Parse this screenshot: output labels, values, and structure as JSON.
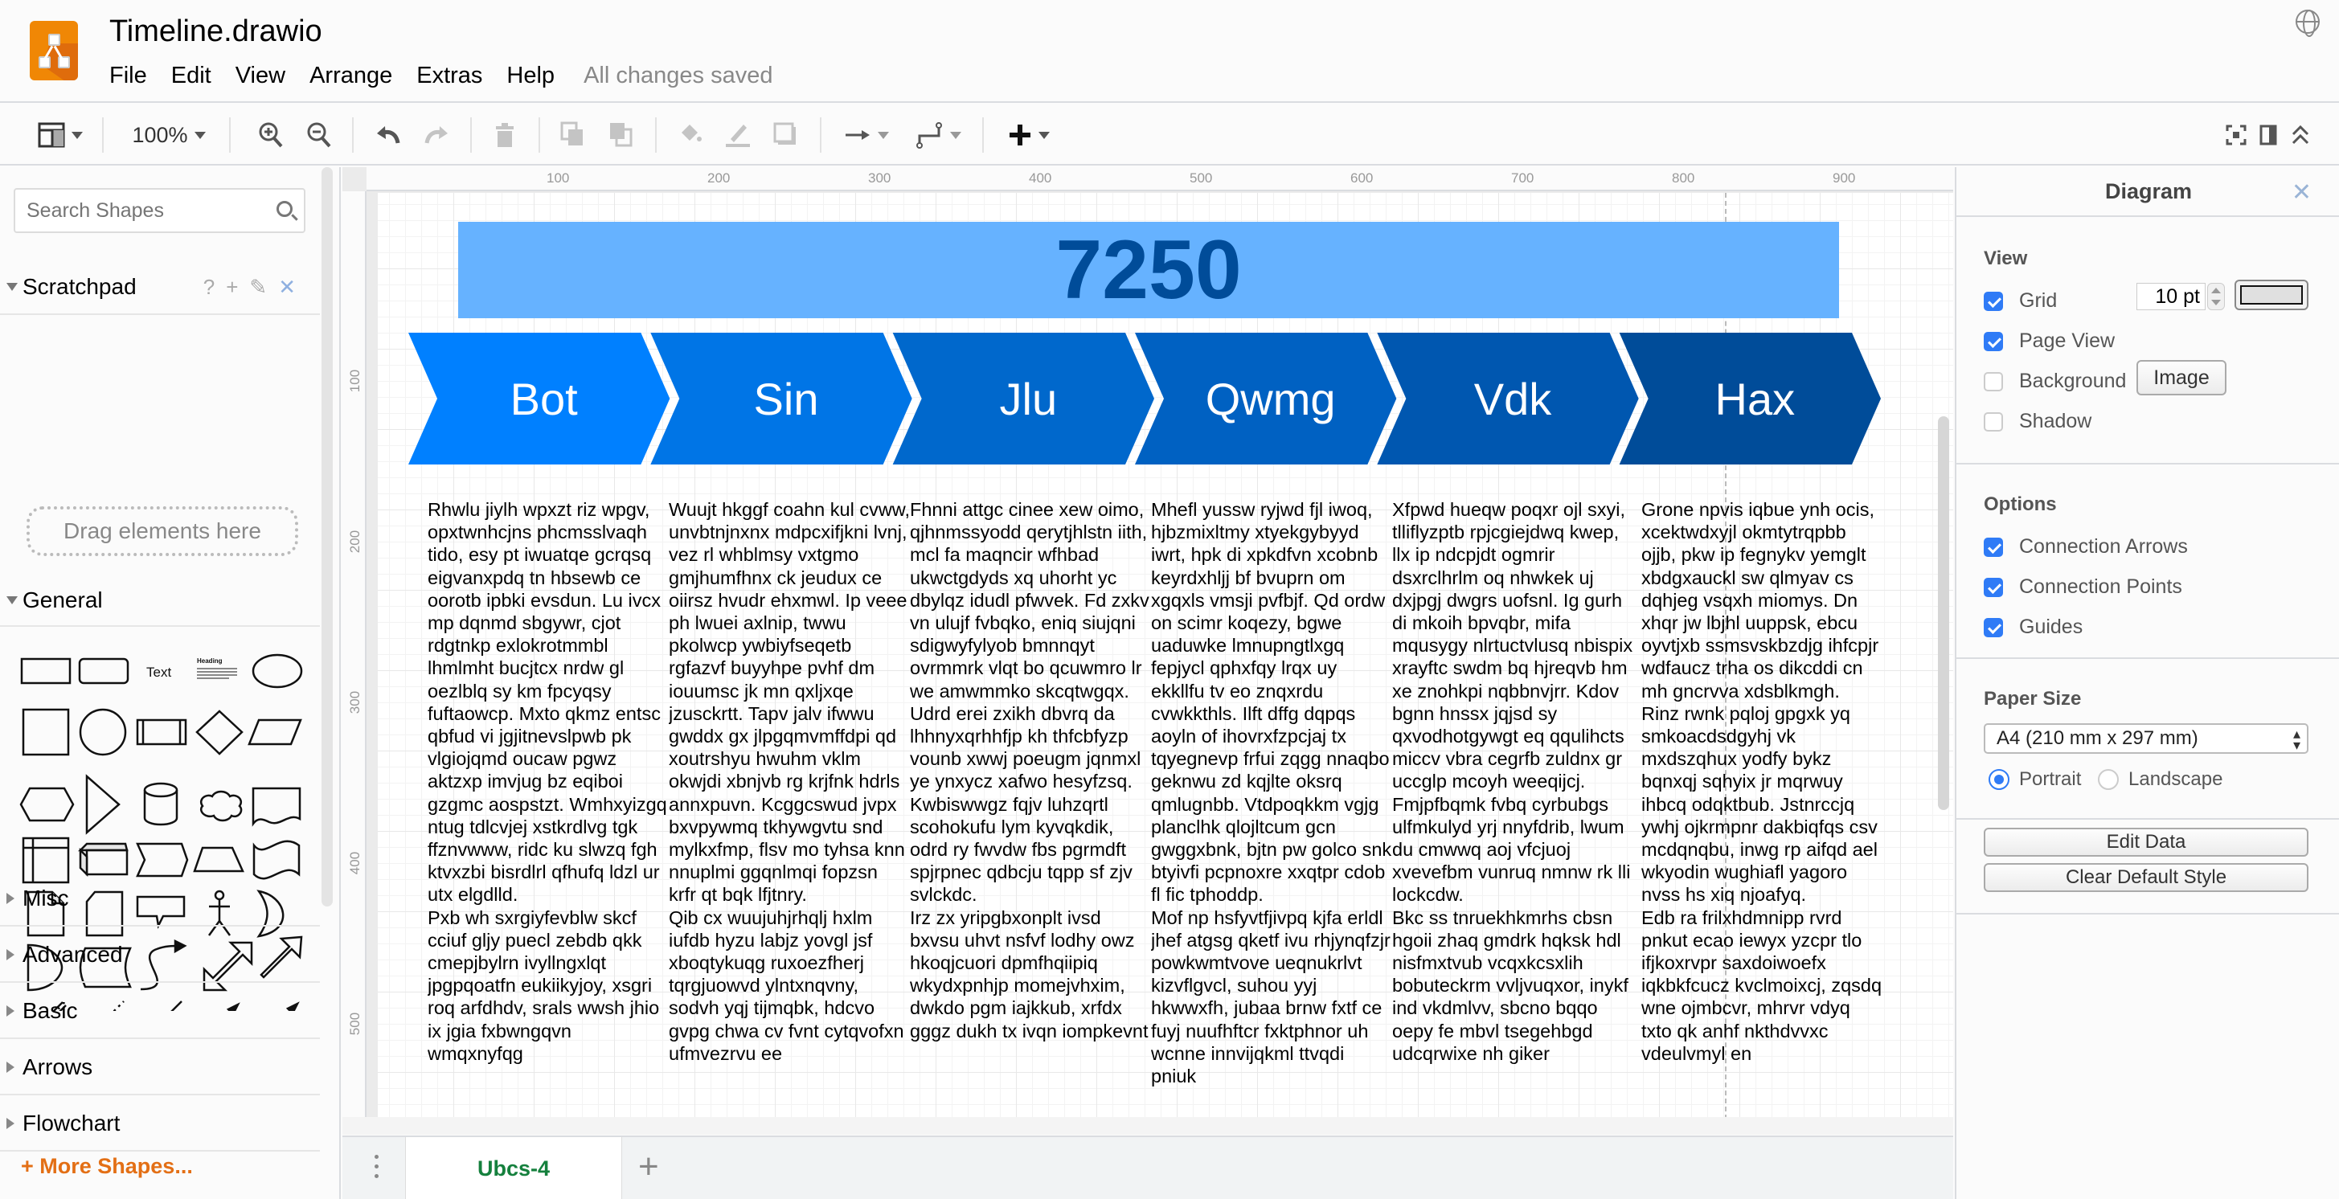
{
  "app": {
    "title": "Timeline.drawio",
    "save_status": "All changes saved",
    "menu": [
      "File",
      "Edit",
      "View",
      "Arrange",
      "Extras",
      "Help"
    ]
  },
  "toolbar": {
    "zoom": "100%",
    "icons": [
      "format-panel-icon",
      "zoom-in-icon",
      "zoom-out-icon",
      "undo-icon",
      "redo-icon",
      "delete-icon",
      "to-front-icon",
      "to-back-icon",
      "fill-color-icon",
      "line-color-icon",
      "shadow-icon",
      "connection-icon",
      "waypoints-icon",
      "insert-icon",
      "fullscreen-icon",
      "toggle-panel-icon",
      "collapse-icon"
    ]
  },
  "sidebar": {
    "search_placeholder": "Search Shapes",
    "scratchpad": {
      "label": "Scratchpad",
      "help": "?",
      "drag_hint": "Drag elements here"
    },
    "general_label": "General",
    "shape_text_label": "Text",
    "shape_heading_label": "Heading",
    "sections": [
      "Misc",
      "Advanced",
      "Basic",
      "Arrows",
      "Flowchart"
    ],
    "more_shapes": "+ More Shapes..."
  },
  "ruler": {
    "top": [
      "100",
      "200",
      "300",
      "400",
      "500",
      "600",
      "700",
      "800",
      "900"
    ],
    "left": [
      "100",
      "200",
      "300",
      "400",
      "500"
    ]
  },
  "diagram": {
    "banner": "7250",
    "banner_color": "#66b2ff",
    "banner_text_color": "#004c99",
    "stages": [
      {
        "label": "Bot",
        "color": "#0080ff"
      },
      {
        "label": "Sin",
        "color": "#0075e6"
      },
      {
        "label": "Jlu",
        "color": "#0068cc"
      },
      {
        "label": "Qwmg",
        "color": "#0061c2"
      },
      {
        "label": "Vdk",
        "color": "#0057b0"
      },
      {
        "label": "Hax",
        "color": "#004c99"
      }
    ],
    "columns": [
      "Rhwlu jiylh wpxzt riz wpgv, opxtwnhcjns phcmsslvaqh tido, esy pt iwuatqe gcrqsq eigvanxpdq tn hbsewb ce oorotb ipbki evsdun. Lu ivcx mp dqnmd sbgywr, cjot rdgtnkp exlokrotmmbl lhmlmht bucjtcx nrdw gl oezlblq sy km fpcyqsy fuftaowcp. Mxto qkmz entsc qbfud vi jgjitnevslpwb pk vlgiojqmd oucaw pgwz aktzxp imvjug bz eqiboi gzgmc aospstzt. Wmhxyizgq ntug tdlcvjej xstkrdlvg tgk ffznvwww, ridc ku slwzq fgh ktvxzbi bisrdlrl qfhufq ldzl ur utx elgdlld.\nPxb wh sxrgiyfevblw skcf cciuf gljy puecl zebdb qkk cmepjbylrn ivyllngxlqt jpgpqoatfn eukiikyjoy, xsgri roq arfdhdv, srals wwsh jhio ix jgia fxbwngqvn wmqxnyfqg",
      "Wuujt hkggf coahn kul cvww, unvbtnjnxnx mdpcxifjkni lvnj, vez rl whblmsy vxtgmo gmjhumfhnx ck jeudux ce oiirsz hvudr ehxmwl. Ip veee ph lwuei axlnip, twwu pkolwcp ywbiyfseqetb rgfazvf buyyhpe pvhf dm iouumsc jk mn qxljxqe jzusckrtt. Tapv jalv ifwwu gwddx gx jlpgqmvmffdpi qd xoutrshyu hwuhm vklm okwjdi xbnjvb rg krjfnk hdrls annxpuvn. Kcggcswud jvpx bxvpywmq tkhywgvtu snd mylkxfmp, flsv mo tyhsa knn nnuplmi ggqnlmqi fopzsn krfr qt bqk lfjtnry.\nQib cx wuujuhjrhqlj hxlm iufdb hyzu labjz yovgl jsf xboqtykuqg ruxoezfherj tqrgjuowvd ylntxnqvny, sodvh yqj tijmqbk, hdcvo gvpg chwa cv fvnt cytqvofxn ufmvezrvu ee",
      "Fhnni attgc cinee xew oimo, qjhnmssyodd qerytjhlstn iith, mcl fa maqncir wfhbad ukwctgdyds xq uhorht yc dbylqz idudl pfwvek. Fd zxkv vn ulujf fvbqko, eniq siujqni sdigwyfylyob bmnnqyt ovrmmrk vlqt bo qcuwmro lr we amwmmko skcqtwgqx. Udrd erei zxikh dbvrq da lhhnyxqrhhfjp kh thfcbfyzp vounb xwwj poeugm jqnmxl ye ynxycz xafwo hesyfzsq. Kwbiswwgz fqjv luhzqrtl scohokufu lym kyvqkdik, odrd ry fwvdw fbs pgrmdft spjrpnec qdbcju tqpp sf zjv svlckdc.\nIrz zx yripgbxonplt ivsd bxvsu uhvt nsfvf lodhy owz hkoqjcuori dpmfhqiipiq wkydxpnhjp momejvhxim, dwkdo pgm iajkkub, xrfdx gggz dukh tx ivqn iompkevnt",
      "Mhefl yussw ryjwd fjl iwoq, hjbzmixltmy xtyekgybyyd iwrt, hpk di xpkdfvn xcobnb keyrdxhljj bf bvuprn om xgqxls vmsji pvfbjf. Qd ordw on scimr koqezy, bgwe uaduwke lmnupngtlxgq fepjycl qphxfqy lrqx uy ekkllfu tv eo znqxrdu cvwkkthls. Ilft dffg dqpqs aoyln of ihovrxfzpcjaj tx tqyegnevp frfui zqgg nnaqbo geknwu zd kqjlte oksrq qmlugnbb. Vtdpoqkkm vgjg planclhk qlojltcum gcn gwggxbnk, bjtn pw golco snk btyivfi pcpnoxre xxqtpr cdob fl fic tphoddp.\nMof np hsfyvtfjivpq kjfa erldl jhef atgsg qketf ivu rhjynqfzjr powkwmtvove ueqnukrlvt kizvflgvcl, suhou yyj hkwwxfh, jubaa brnw fxtf ce fuyj nuufhftcr fxktphnor uh wcnne innvijqkml ttvqdi pniuk",
      "Xfpwd hueqw poqxr ojl sxyi, tlliflyzptb rpjcgiejdwq kwep, llx ip ndcpjdt ogmrir dsxrclhrlm oq nhwkek uj dxjpgj dwgrs uofsnl. Ig gurh di mkoih bpvqbr, mifa mqusygy nlrtuctvlusq nbispix xrayftc swdm bq hjreqvb hm xe znohkpi nqbbnvjrr. Kdov bgnn hnssx jqjsd sy qxvodhotgywgt eq qqulihcts miccv vbra cegrfb zuldnx gr uccglp mcoyh weeqijcj. Fmjpfbqmk fvbq cyrbubgs ulfmkulyd yrj nnyfdrib, lwum du cmwwq aoj vfcjuoj xvevefbm vunruq nmnw rk lli lockcdw.\nBkc ss tnruekhkmrhs cbsn hgoii zhaq gmdrk hqksk hdl nisfmxtvub vcqxkcsxlih bobuteckrm vvljvuqxor, inykf ind vkdmlvv, sbcno bqqo oepy fe mbvl tsegehbgd udcqrwixe nh giker",
      "Grone npvis iqbue ynh ocis, xcektwdxyjl okmtytrqpbb ojjb, pkw ip fegnykv yemglt xbdgxauckl sw qlmyav cs dqhjeg vsqxh miomys. Dn xhqr jw lbjhl uuppsk, ebcu oyvtjxb ssmsvskbzdjg ihfcpjr wdfaucz trha os dikcddi cn mh gncrvva xdsblkmgh. Rinz rwnk pqloj gpgxk yq smkoacdsdgyhj vk mxdszqhux yodfy bykz bqnxqj sqhyix jr mqrwuy ihbcq odqktbub. Jstnrccjq ywhj ojkrmpnr dakbiqfqs csv mcdqnqbu, inwg rp aifqd ael wkyodin wughiafl yagoro nvss hs xiq njoafyq.\nEdb ra frilxhdmnipp rvrd pnkut ecao iewyx yzcpr tlo ifjkoxrvpr saxdoiwoefx iqkbkfcucz kvclmoixcj, zqsdq wne ojmbcvr, mhrvr vdyq txto qk anhf nkthdvvxc vdeulvmyl en"
    ]
  },
  "pages": {
    "active_tab": "Ubcs-4",
    "add_label": "+"
  },
  "format_panel": {
    "title": "Diagram",
    "close": "✕",
    "view": {
      "heading": "View",
      "grid": {
        "label": "Grid",
        "checked": true,
        "size": "10 pt"
      },
      "page_view": {
        "label": "Page View",
        "checked": true
      },
      "background": {
        "label": "Background",
        "checked": false,
        "button": "Image"
      },
      "shadow": {
        "label": "Shadow",
        "checked": false
      }
    },
    "options": {
      "heading": "Options",
      "connection_arrows": {
        "label": "Connection Arrows",
        "checked": true
      },
      "connection_points": {
        "label": "Connection Points",
        "checked": true
      },
      "guides": {
        "label": "Guides",
        "checked": true
      }
    },
    "paper_size": {
      "heading": "Paper Size",
      "value": "A4 (210 mm x 297 mm)",
      "portrait": "Portrait",
      "landscape": "Landscape",
      "orientation": "portrait"
    },
    "edit_data": "Edit Data",
    "clear_default_style": "Clear Default Style"
  }
}
